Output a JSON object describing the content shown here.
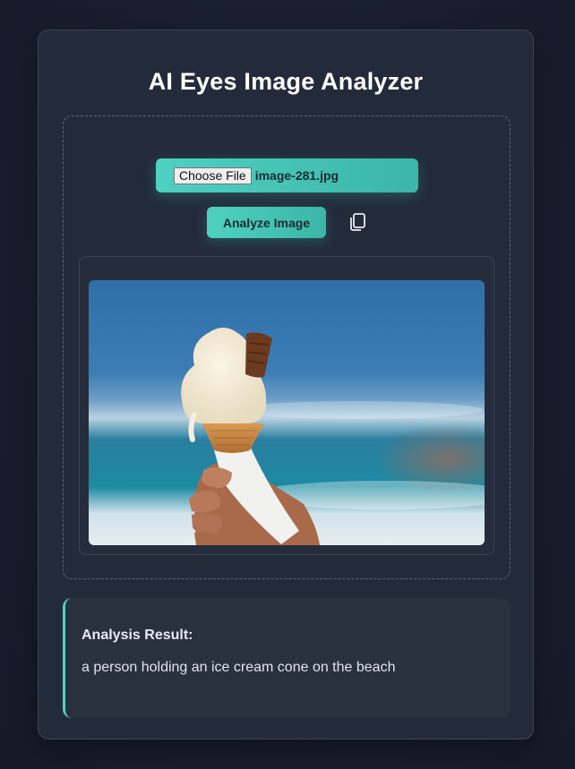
{
  "app": {
    "title": "AI Eyes Image Analyzer"
  },
  "upload": {
    "choose_file_label": "Choose File",
    "file_name": "image-281.jpg"
  },
  "actions": {
    "analyze_label": "Analyze Image",
    "copy_icon": "copy-icon"
  },
  "preview": {
    "image_subject": "ice-cream-cone-beach-photo"
  },
  "result": {
    "heading": "Analysis Result:",
    "text": "a person holding an ice cream cone on the beach"
  },
  "colors": {
    "accent": "#4fd1c0",
    "background": "#171d2c",
    "card": "#232b3b"
  }
}
